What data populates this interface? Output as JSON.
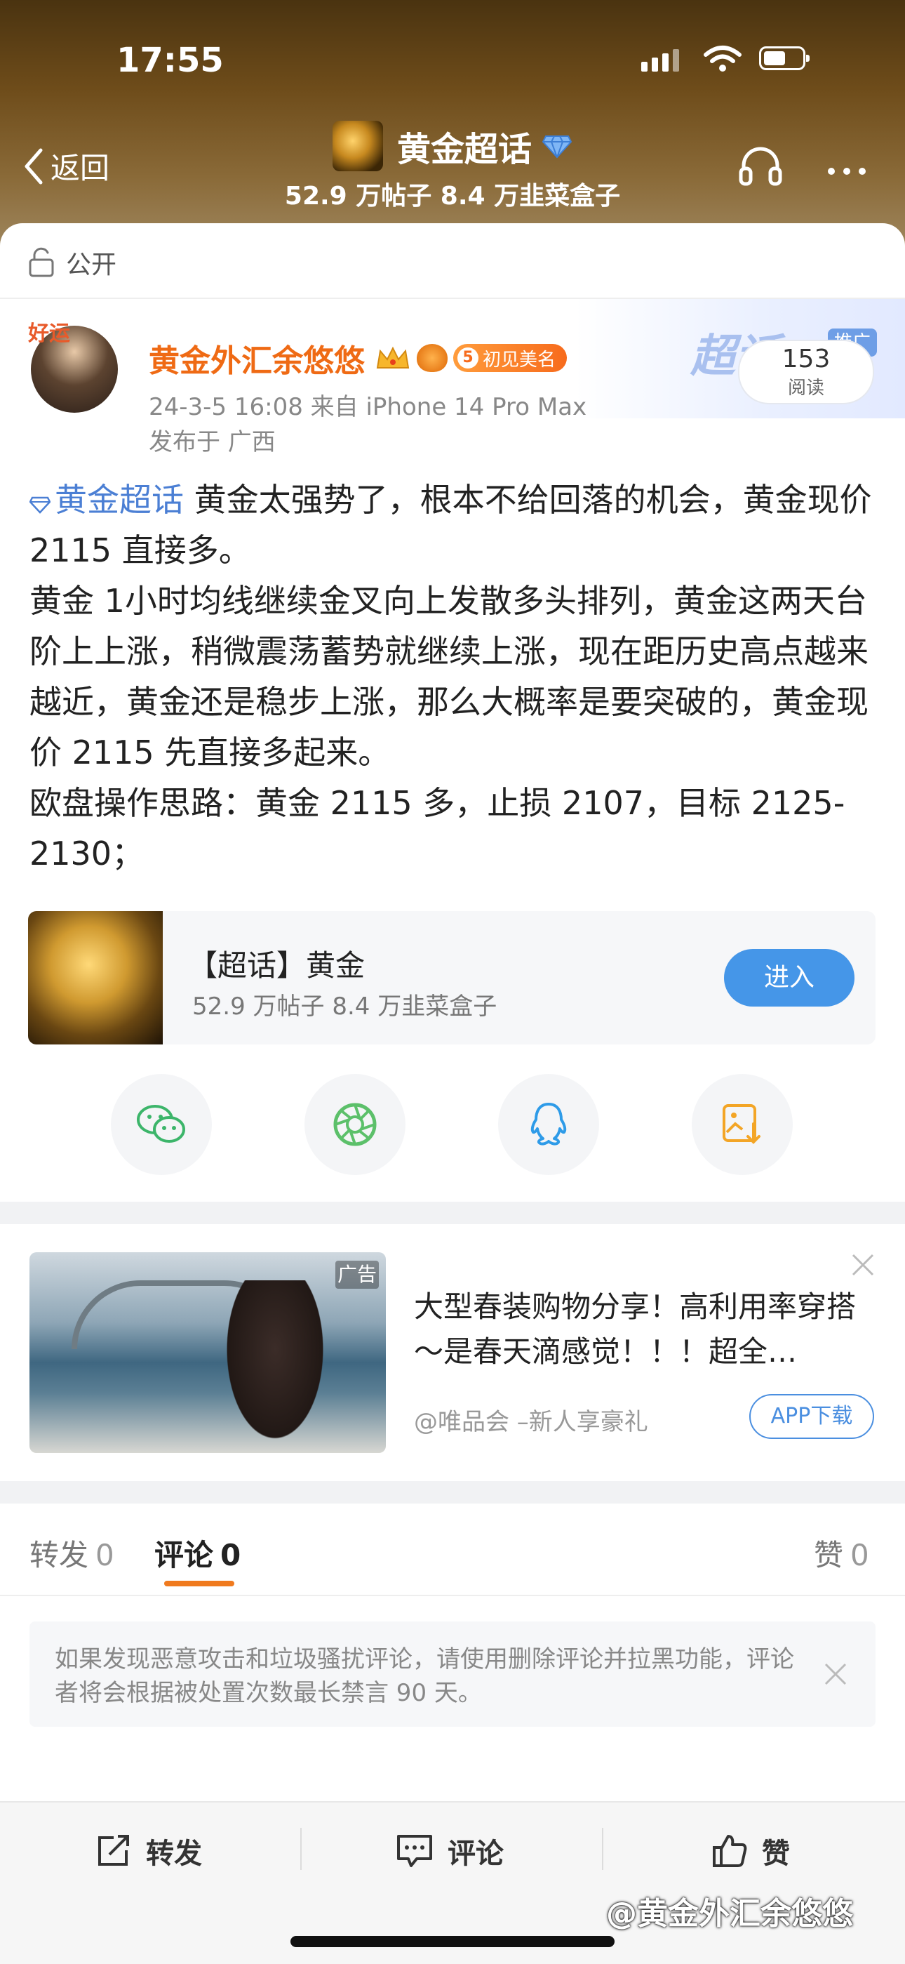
{
  "status_bar": {
    "time": "17:55"
  },
  "nav": {
    "back_label": "返回",
    "title": "黄金超话",
    "subtitle": "52.9 万帖子  8.4 万韭菜盒子"
  },
  "visibility": "公开",
  "promo": {
    "text": "超话",
    "ad_tag": "推广",
    "read_count": "153",
    "read_label": "阅读"
  },
  "post": {
    "author": "黄金外汇余悠悠",
    "avatar_deco": "好运",
    "level_num": "5",
    "level_label": "初见美名",
    "meta": "24-3-5 16:08  来自 iPhone 14 Pro Max",
    "location": "发布于 广西",
    "topic": "黄金超话",
    "lines": [
      " 黄金太强势了，根本不给回落的机会，黄金现价 2115 直接多。",
      "黄金 1小时均线继续金叉向上发散多头排列，黄金这两天台阶上上涨，稍微震荡蓄势就继续上涨，现在距历史高点越来越近，黄金还是稳步上涨，那么大概率是要突破的，黄金现价 2115 先直接多起来。",
      "欧盘操作思路：黄金 2115 多，止损 2107，目标 2125-2130；"
    ]
  },
  "topic_card": {
    "name": "【超话】黄金",
    "stats": "52.9 万帖子  8.4 万韭菜盒子",
    "enter_label": "进入"
  },
  "share": [
    "wechat-icon",
    "moments-icon",
    "qq-icon",
    "save-image-icon"
  ],
  "ad": {
    "label": "广告",
    "title": "大型春装购物分享！高利用率穿搭～是春天滴感觉！！！超全…",
    "source": "@唯品会 –新人享豪礼",
    "button": "APP下载"
  },
  "tabs": {
    "repost_label": "转发",
    "repost_count": "0",
    "comment_label": "评论",
    "comment_count": "0",
    "like_label": "赞",
    "like_count": "0"
  },
  "notice": "如果发现恶意攻击和垃圾骚扰评论，请使用删除评论并拉黑功能，评论者将会根据被处置次数最长禁言 90 天。",
  "bottom_bar": {
    "repost": "转发",
    "comment": "评论",
    "like": "赞"
  },
  "watermark": "@黄金外汇余悠悠",
  "colors": {
    "accent_orange": "#f07a1e",
    "link_blue": "#4b7fd4",
    "button_blue": "#4596e8"
  }
}
